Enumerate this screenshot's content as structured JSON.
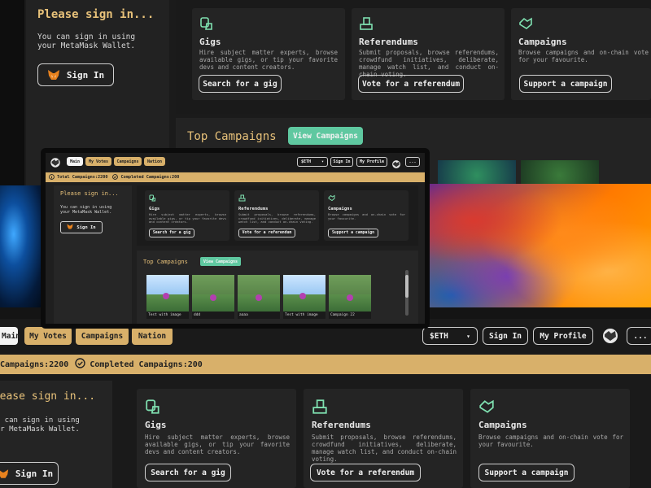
{
  "signin": {
    "heading": "Please sign in...",
    "line1": "You can sign in using",
    "line2": "your MetaMask Wallet.",
    "button": "Sign In"
  },
  "cards": [
    {
      "title": "Gigs",
      "desc": "Hire subject matter experts, browse available gigs, or tip your favorite devs and content creators.",
      "button": "Search for a gig",
      "icon": "gigs-icon"
    },
    {
      "title": "Referendums",
      "desc": "Submit proposals, browse referendums, crowdfund initiatives, deliberate, manage watch list, and conduct on-chain voting.",
      "button": "Vote for a referendum",
      "icon": "ballot-icon"
    },
    {
      "title": "Campaigns",
      "desc": "Browse campaigns and on-chain vote for your favourite.",
      "button": "Support a campaign",
      "icon": "handshake-icon"
    }
  ],
  "top_campaigns": {
    "title": "Top Campaigns",
    "view_button": "View Campaigns",
    "thumbs": [
      "Test with image",
      "ddd",
      "aaaa",
      "Test with image",
      "Campaign 22"
    ]
  },
  "nav": {
    "tabs": [
      "Main",
      "My Votes",
      "Campaigns",
      "Nation"
    ],
    "currency": "$ETH",
    "sign_in": "Sign In",
    "profile": "My Profile",
    "more": "..."
  },
  "stats": {
    "total_label": "Total Campaigns:",
    "total_value": "2200",
    "bottom_total_label": "Campaigns:",
    "completed_label": "Completed Campaigns:",
    "completed_value": "200"
  },
  "colors": {
    "gold": "#d8b06a",
    "teal": "#5fc8a0",
    "bg": "#1f1f1f",
    "card": "#242424"
  }
}
